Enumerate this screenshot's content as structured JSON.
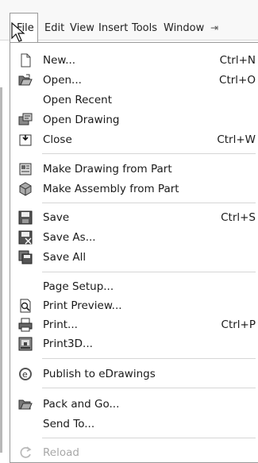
{
  "menubar": {
    "items": [
      "File",
      "Edit",
      "View",
      "Insert",
      "Tools",
      "Window"
    ],
    "pin_icon": "pin-icon"
  },
  "file_menu": {
    "items": [
      {
        "label": "New...",
        "shortcut": "Ctrl+N",
        "icon": "new-document-icon"
      },
      {
        "label": "Open...",
        "shortcut": "Ctrl+O",
        "icon": "open-folder-icon"
      },
      {
        "label": "Open Recent",
        "shortcut": "",
        "icon": ""
      },
      {
        "label": "Open Drawing",
        "shortcut": "",
        "icon": "open-drawing-icon"
      },
      {
        "label": "Close",
        "shortcut": "Ctrl+W",
        "icon": "close-document-icon"
      },
      {
        "label": "Make Drawing from Part",
        "shortcut": "",
        "icon": "make-drawing-icon"
      },
      {
        "label": "Make Assembly from Part",
        "shortcut": "",
        "icon": "make-assembly-icon"
      },
      {
        "label": "Save",
        "shortcut": "Ctrl+S",
        "icon": "save-icon"
      },
      {
        "label": "Save As...",
        "shortcut": "",
        "icon": "save-as-icon"
      },
      {
        "label": "Save All",
        "shortcut": "",
        "icon": "save-all-icon"
      },
      {
        "label": "Page Setup...",
        "shortcut": "",
        "icon": ""
      },
      {
        "label": "Print Preview...",
        "shortcut": "",
        "icon": "print-preview-icon"
      },
      {
        "label": "Print...",
        "shortcut": "Ctrl+P",
        "icon": "printer-icon"
      },
      {
        "label": "Print3D...",
        "shortcut": "",
        "icon": "print3d-icon"
      },
      {
        "label": "Publish to eDrawings",
        "shortcut": "",
        "icon": "edrawings-icon"
      },
      {
        "label": "Pack and Go...",
        "shortcut": "",
        "icon": "pack-and-go-icon"
      },
      {
        "label": "Send To...",
        "shortcut": "",
        "icon": ""
      },
      {
        "label": "Reload",
        "shortcut": "",
        "icon": "reload-icon",
        "disabled": true
      }
    ]
  }
}
